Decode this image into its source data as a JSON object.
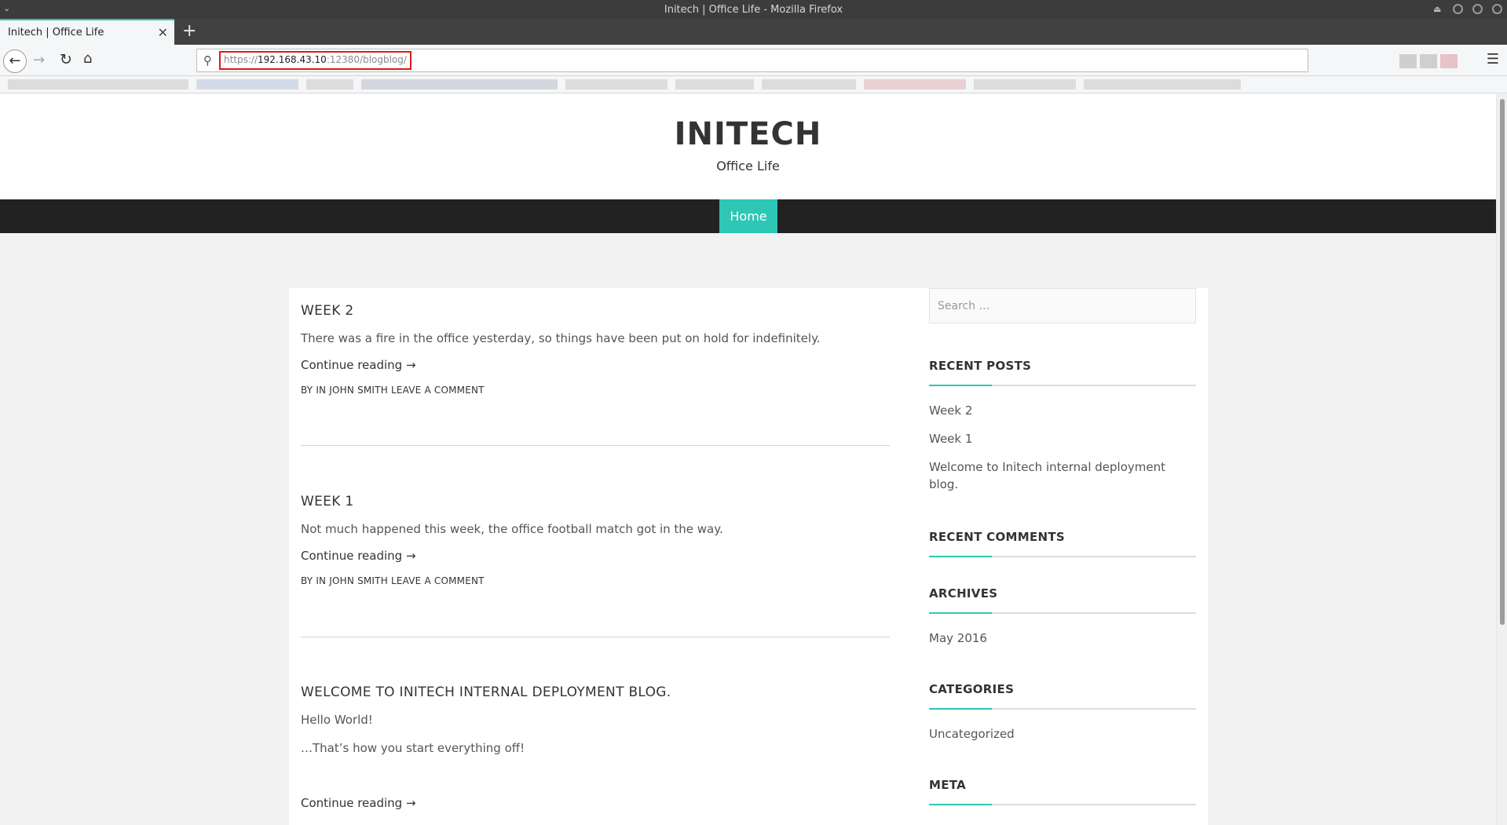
{
  "browser": {
    "window_title": "Initech | Office Life - Mozilla Firefox",
    "tab_title": "Initech | Office Life",
    "url_scheme": "https://",
    "url_host": "192.168.43.10",
    "url_rest": ":12380/blogblog/",
    "icons": {
      "back": "←",
      "forward": "→",
      "reload": "↻",
      "home": "⌂",
      "search": "⚲",
      "menu": "☰",
      "close": "✕",
      "new_tab": "+",
      "title_menu": "⌄",
      "eject": "⏏"
    }
  },
  "site": {
    "title": "INITECH",
    "tagline": "Office Life",
    "nav": {
      "home_label": "Home"
    }
  },
  "posts": [
    {
      "title": "WEEK 2",
      "excerpt": "There was a fire in the office yesterday, so things have been put on hold for  indefinitely.",
      "more": "Continue reading →",
      "meta_prefix": "BY  IN",
      "author": "JOHN SMITH",
      "comment": "LEAVE A COMMENT"
    },
    {
      "title": "WEEK 1",
      "excerpt": "Not much happened this week, the office football match got in the way.",
      "more": "Continue reading →",
      "meta_prefix": "BY  IN",
      "author": "JOHN SMITH",
      "comment": "LEAVE A COMMENT"
    },
    {
      "title": "WELCOME TO INITECH INTERNAL DEPLOYMENT BLOG.",
      "excerpt": "Hello World!",
      "excerpt2": "…That’s how you start everything off!",
      "more": "Continue reading →"
    }
  ],
  "sidebar": {
    "search_placeholder": "Search …",
    "recent_posts": {
      "title": "RECENT POSTS",
      "items": [
        "Week 2",
        "Week 1",
        "Welcome to Initech internal deployment blog."
      ]
    },
    "recent_comments": {
      "title": "RECENT COMMENTS"
    },
    "archives": {
      "title": "ARCHIVES",
      "items": [
        "May 2016"
      ]
    },
    "categories": {
      "title": "CATEGORIES",
      "items": [
        "Uncategorized"
      ]
    },
    "meta": {
      "title": "META"
    }
  },
  "colors": {
    "accent": "#2ec6b5",
    "nav_bg": "#222222",
    "highlight_box": "#e01818"
  }
}
